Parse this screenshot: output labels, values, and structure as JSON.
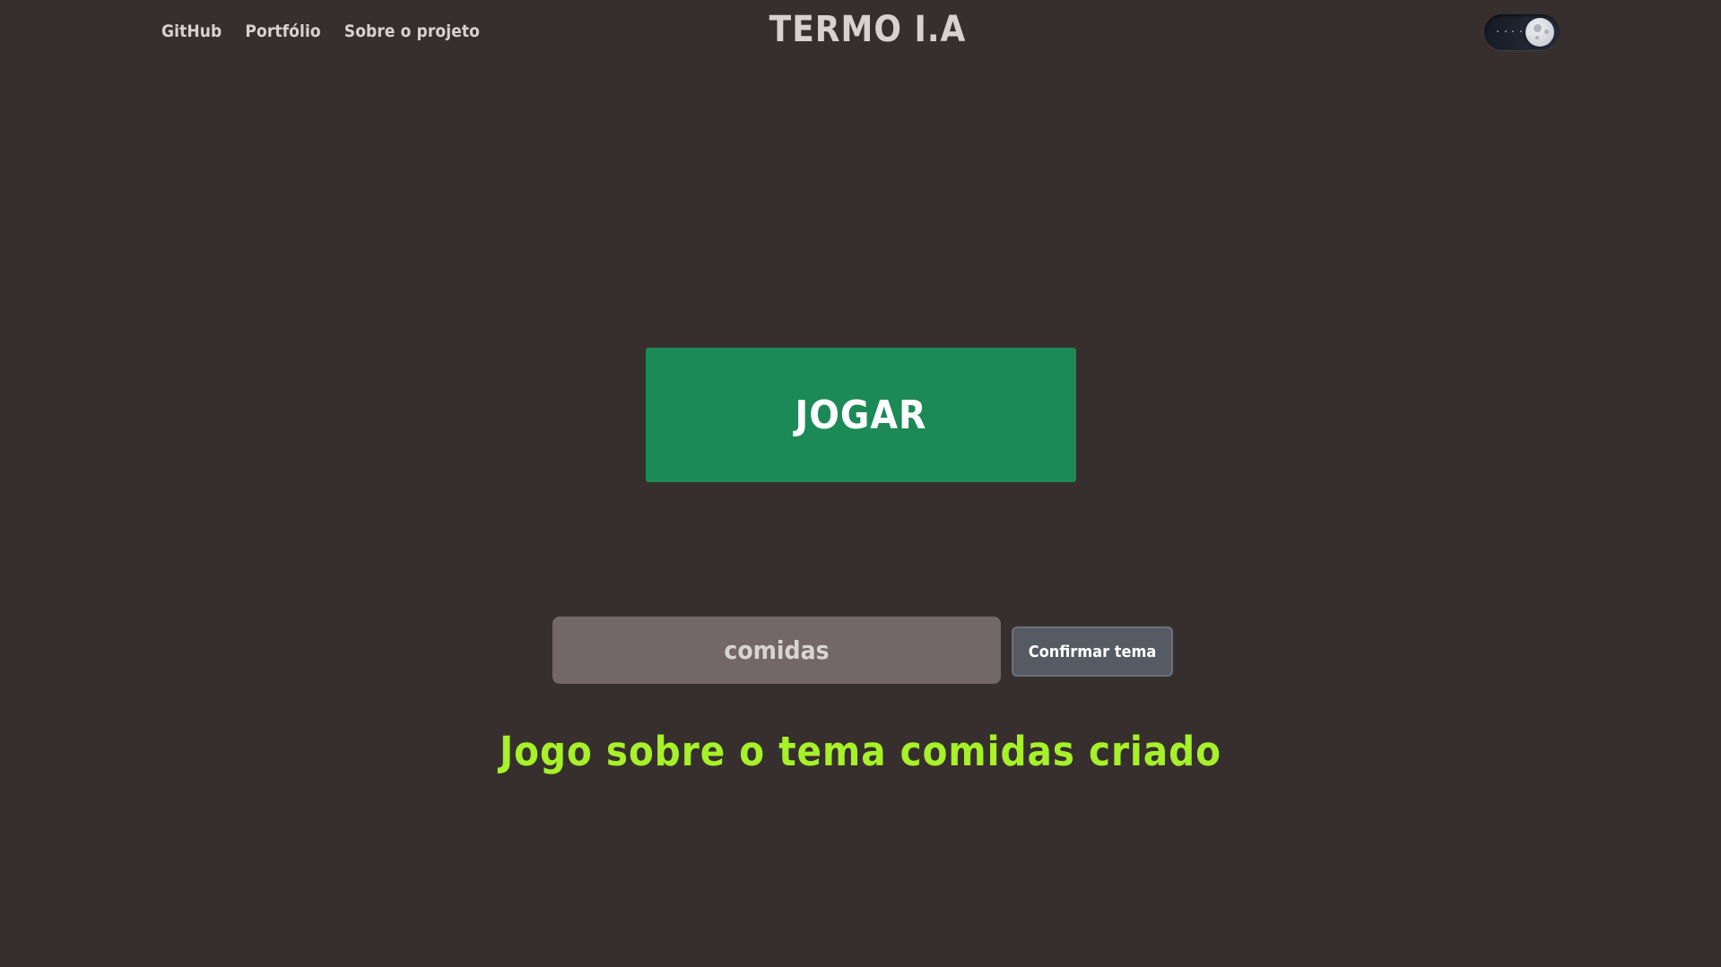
{
  "nav": {
    "items": [
      {
        "label": "GitHub"
      },
      {
        "label": "Portfólio"
      },
      {
        "label": "Sobre o projeto"
      }
    ]
  },
  "header": {
    "title": "TERMO I.A"
  },
  "theme_toggle": {
    "mode": "dark",
    "icon": "moon-icon"
  },
  "main": {
    "play_label": "JOGAR",
    "theme_input_value": "comidas",
    "confirm_label": "Confirmar tema",
    "status_message": "Jogo sobre o tema comidas criado"
  },
  "colors": {
    "background": "#372f2e",
    "play_button": "#1b8a56",
    "input_background": "#726867",
    "confirm_button": "#565a62",
    "status_text": "#a6f128"
  }
}
